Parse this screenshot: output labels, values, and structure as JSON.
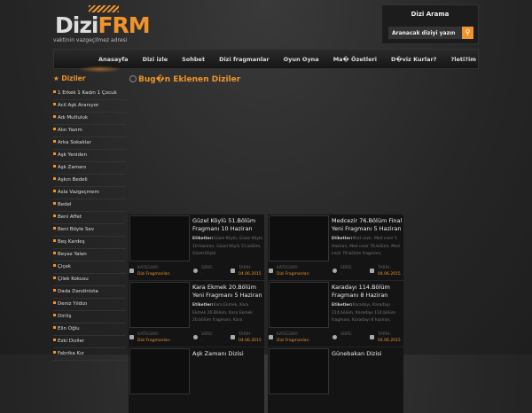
{
  "logo": {
    "text_a": "Dizi",
    "text_b": "FRM",
    "tagline": "vaktinin vazgeçilmez adresi"
  },
  "search": {
    "heading": "Dizi Arama",
    "placeholder": "Aranacak diziyi yazın",
    "icon": "search-icon"
  },
  "nav": [
    "Anasayfa",
    "Dizi izle",
    "Sohbet",
    "Dizi fragmanlar",
    "Oyun Oyna",
    "Ma� Özetleri",
    "D�viz Kurlar?",
    "?leti?im"
  ],
  "sidebar": {
    "heading": "Diziler",
    "items": [
      "1 Erkek 1 Kadın 1 Çocuk",
      "Acil Aşk Aranıyor",
      "Adı Mutluluk",
      "Alın Yazım",
      "Arka Sokaklar",
      "Aşk Yeniden",
      "Aşk Zamanı",
      "Aşkın Bedeli",
      "Asla Vazgeçmem",
      "Bedel",
      "Beni Affet",
      "Beni Böyle Sev",
      "Beş Kardeş",
      "Beyaz Yalan",
      "Çiçek",
      "Çilek Kokusu",
      "Dada Dandinista",
      "Deniz Yıldızı",
      "Diriliş",
      "Elin Oğlu",
      "Eski Diziler",
      "Fabrika Kız"
    ]
  },
  "main": {
    "title": "Bug�n Eklenen Diziler",
    "labels": {
      "tags": "Etiketler:",
      "category": "KATEGORİ:",
      "duration": "SÜRE:",
      "date": "TARİH:"
    },
    "cards": [
      {
        "title": "Güzel Köylü 51.Bölüm Fragmanı 10 Haziran",
        "tags": "Güzel Köylü, Güzel Köylü 10 Haziran, Güzel Köylü 51.bölüm, Güzel Köylü",
        "category": "Dizi Fragmanları",
        "duration": "-",
        "date": "04.06.2015"
      },
      {
        "title": "Medcezir 76.Bölüm Final Yeni Fragmanı 5 Haziran",
        "tags": "Med cezir, Med cezir 5 Haziran, Med cezir 76.bölüm, Med cezir 76.bölüm fragmanı,",
        "category": "Dizi Fragmanları",
        "duration": "-",
        "date": "04.06.2015"
      },
      {
        "title": "Kara Ekmek 20.Bölüm Yeni Fragmanı 5 Haziran",
        "tags": "Kara Ekmek, Kara Ekmek 20.Bölüm, Kara Ekmek 20.bölüm fragmanı, Kara",
        "category": "Dizi Fragmanları",
        "duration": "-",
        "date": "04.06.2015"
      },
      {
        "title": "Karadayı 114.Bölüm Fragmanı 8 Haziran",
        "tags": "Karadayı, Karadayı 114.bölüm, Karadayı 114.bölüm fragmanı, Karadayı 8 haziran,",
        "category": "Dizi Fragmanları",
        "duration": "-",
        "date": "04.06.2015"
      },
      {
        "title": "Aşk Zamanı Dizisi",
        "tags": "",
        "category": "",
        "duration": "",
        "date": ""
      },
      {
        "title": "Günebakan Dizisi",
        "tags": "",
        "category": "",
        "duration": "",
        "date": ""
      }
    ]
  }
}
